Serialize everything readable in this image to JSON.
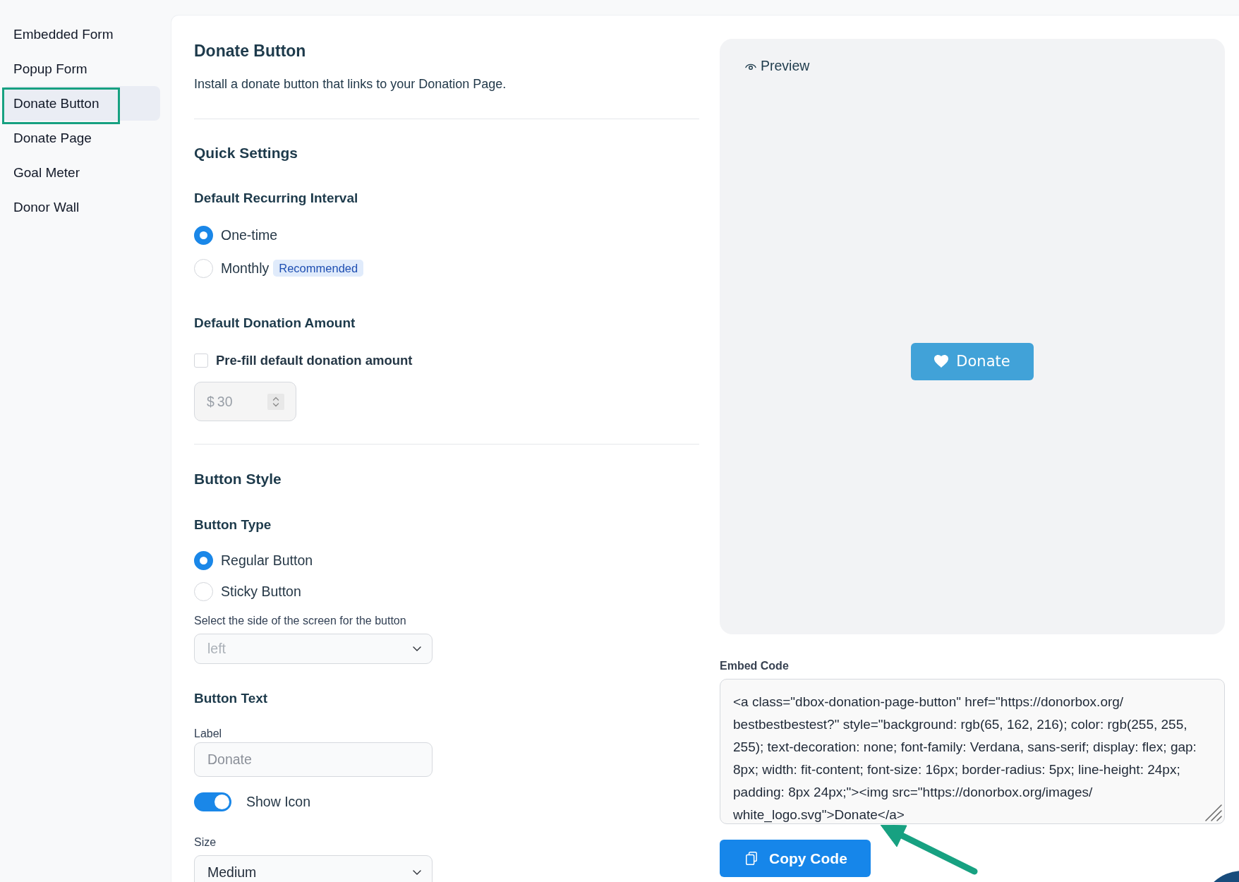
{
  "sidebar": {
    "items": [
      {
        "label": "Embedded Form",
        "selected": false,
        "outlined": false
      },
      {
        "label": "Popup Form",
        "selected": false,
        "outlined": false
      },
      {
        "label": "Donate Button",
        "selected": true,
        "outlined": true
      },
      {
        "label": "Donate Page",
        "selected": false,
        "outlined": false
      },
      {
        "label": "Goal Meter",
        "selected": false,
        "outlined": false
      },
      {
        "label": "Donor Wall",
        "selected": false,
        "outlined": false
      }
    ]
  },
  "header": {
    "title": "Donate Button",
    "description": "Install a donate button that links to your Donation Page."
  },
  "quick_settings": {
    "title": "Quick Settings",
    "recurring_interval": {
      "label": "Default Recurring Interval",
      "options": [
        {
          "label": "One-time",
          "selected": true
        },
        {
          "label": "Monthly",
          "selected": false,
          "badge": "Recommended"
        }
      ]
    },
    "donation_amount": {
      "label": "Default Donation Amount",
      "prefill": {
        "label": "Pre-fill default donation amount",
        "checked": false
      },
      "amount_field": {
        "prefix": "$",
        "value": "30",
        "disabled": true
      }
    }
  },
  "button_style": {
    "title": "Button Style",
    "button_type": {
      "label": "Button Type",
      "options": [
        {
          "label": "Regular Button",
          "selected": true
        },
        {
          "label": "Sticky Button",
          "selected": false
        }
      ],
      "side_select": {
        "label": "Select the side of the screen for the button",
        "value": "left",
        "disabled": true
      }
    },
    "button_text": {
      "label": "Button Text",
      "label_field": {
        "label": "Label",
        "placeholder": "Donate"
      },
      "show_icon": {
        "label": "Show Icon",
        "on": true
      },
      "size_select": {
        "label": "Size",
        "value": "Medium",
        "disabled": false
      }
    }
  },
  "preview": {
    "title": "Preview",
    "button_label": "Donate"
  },
  "embed": {
    "label": "Embed Code",
    "code": "<a class=\"dbox-donation-page-button\" href=\"https://donorbox.org/bestbestbestest?\" style=\"background: rgb(65, 162, 216); color: rgb(255, 255, 255); text-decoration: none; font-family: Verdana, sans-serif; display: flex; gap: 8px; width: fit-content; font-size: 16px; border-radius: 5px; line-height: 24px; padding: 8px 24px;\"><img src=\"https://donorbox.org/images/white_logo.svg\">Donate</a>",
    "copy_button": "Copy Code",
    "arrow_callout": true
  }
}
